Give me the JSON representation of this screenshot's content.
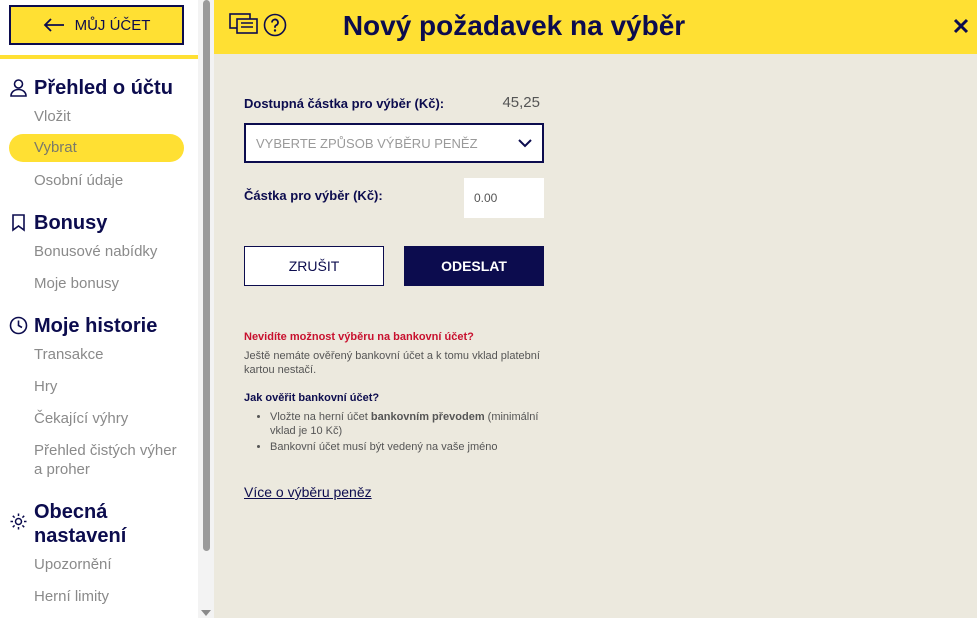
{
  "sidebar": {
    "back_label": "MŮJ ÚČET",
    "sections": [
      {
        "title": "Přehled o účtu",
        "icon": "user-icon"
      },
      {
        "title": "Bonusy",
        "icon": "bookmark-icon"
      },
      {
        "title": "Moje historie",
        "icon": "clock-icon"
      },
      {
        "title": "Obecná nastavení",
        "title_line1": "Obecná",
        "title_line2": "nastavení",
        "icon": "gear-icon"
      }
    ],
    "items": {
      "deposit": "Vložit",
      "withdraw": "Vybrat",
      "personal": "Osobní údaje",
      "bonus_offers": "Bonusové nabídky",
      "my_bonuses": "Moje bonusy",
      "transactions": "Transakce",
      "games": "Hry",
      "pending": "Čekající výhry",
      "net_line1": "Přehled čistých výher",
      "net_line2": "a proher",
      "notifications": "Upozornění",
      "limits": "Herní limity"
    }
  },
  "header": {
    "title": "Nový požadavek na výběr"
  },
  "form": {
    "available_label": "Dostupná částka pro výběr (Kč):",
    "available_value": "45,25",
    "method_placeholder": "VYBERTE ZPŮSOB VÝBĚRU PENĚZ",
    "amount_label": "Částka pro výběr (Kč):",
    "amount_placeholder": "0.00",
    "cancel_label": "ZRUŠIT",
    "submit_label": "ODESLAT"
  },
  "info": {
    "warning_title": "Nevidíte možnost výběru na bankovní účet?",
    "warning_text": "Ještě nemáte ověřený bankovní účet a k tomu vklad platební kartou nestačí.",
    "how_title": "Jak ověřit bankovní účet?",
    "bullet1_pre": "Vložte na herní účet ",
    "bullet1_bold": "bankovním převodem",
    "bullet1_post": " (minimální vklad je 10 Kč)",
    "bullet2": "Bankovní účet musí být vedený na vaše jméno",
    "more_link": "Více o výběru peněz"
  },
  "colors": {
    "accent": "#ffe033",
    "navy": "#0c0c4e",
    "warning": "#c8102e",
    "background": "#ece9de"
  }
}
